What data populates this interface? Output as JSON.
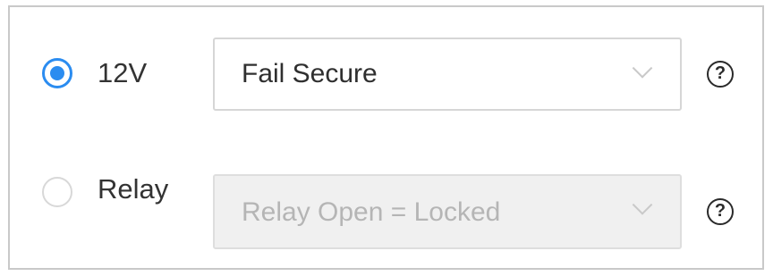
{
  "options": [
    {
      "label": "12V",
      "selected": true,
      "dropdown": {
        "value": "Fail Secure",
        "enabled": true
      },
      "help_icon": "question-circle-icon",
      "help_glyph": "?"
    },
    {
      "label": "Relay",
      "selected": false,
      "dropdown": {
        "value": "Relay Open = Locked",
        "enabled": false
      },
      "help_icon": "question-circle-icon",
      "help_glyph": "?"
    }
  ],
  "colors": {
    "accent": "#2b8cf0",
    "border": "#c9c9c9",
    "disabled_bg": "#f0f0f0",
    "disabled_text": "#b5b5b5"
  }
}
